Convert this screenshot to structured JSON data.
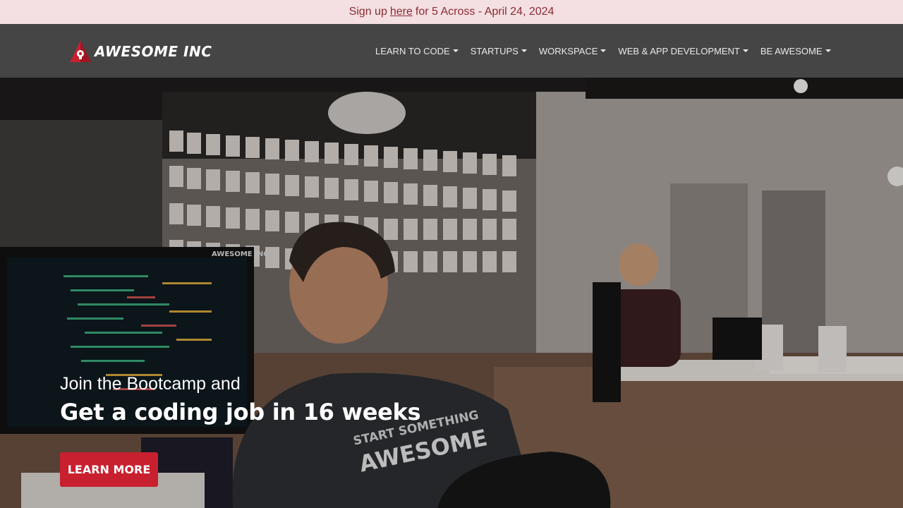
{
  "announcement": {
    "prefix": "Sign up",
    "link_text": "here",
    "suffix": "for 5 Across - April 24, 2024",
    "bg_color": "#f4e0e2",
    "text_color": "#8b2a33"
  },
  "header": {
    "logo_text": "AWESOME INC",
    "logo_icon": "lightbulb-triangle-icon",
    "bg_color": "#454545",
    "nav": [
      {
        "label": "LEARN TO CODE",
        "icon": "caret-down-icon"
      },
      {
        "label": "STARTUPS",
        "icon": "caret-down-icon"
      },
      {
        "label": "WORKSPACE",
        "icon": "caret-down-icon"
      },
      {
        "label": "WEB & APP DEVELOPMENT",
        "icon": "caret-down-icon"
      },
      {
        "label": "BE AWESOME",
        "icon": "caret-down-icon"
      }
    ]
  },
  "hero": {
    "subtitle": "Join the Bootcamp and",
    "title": "Get a coding job in 16 weeks",
    "cta_label": "LEARN MORE",
    "cta_color": "#c8202f",
    "monitor_brand": "AWESOME INC",
    "shirt_text_line1": "START SOMETHING",
    "shirt_text_line2": "AWESOME"
  }
}
